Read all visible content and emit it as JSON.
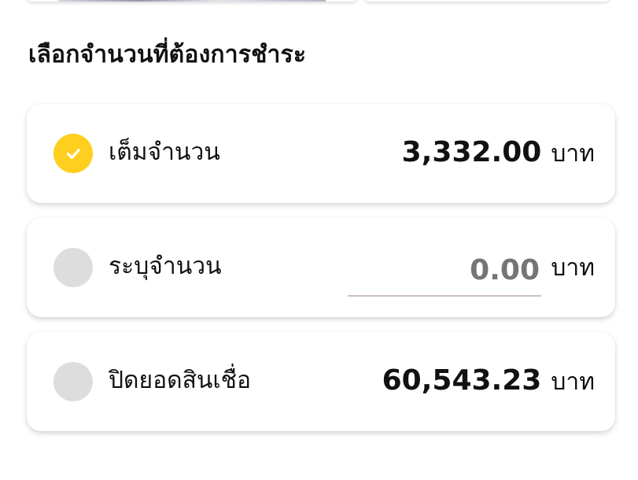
{
  "section_title": "เลือกจำนวนที่ต้องการชำระ",
  "options": [
    {
      "label": "เต็มจำนวน",
      "amount": "3,332.00",
      "unit": "บาท",
      "selected": true
    },
    {
      "label": "ระบุจำนวน",
      "amount_placeholder": "0.00",
      "unit": "บาท",
      "selected": false
    },
    {
      "label": "ปิดยอดสินเชื่อ",
      "amount": "60,543.23",
      "unit": "บาท",
      "selected": false
    }
  ],
  "colors": {
    "accent": "#ffcf1f",
    "radio_unselected": "#dddddd",
    "input_underline": "#cbbfbd"
  },
  "icons": {
    "selected_radio": "check-icon"
  }
}
